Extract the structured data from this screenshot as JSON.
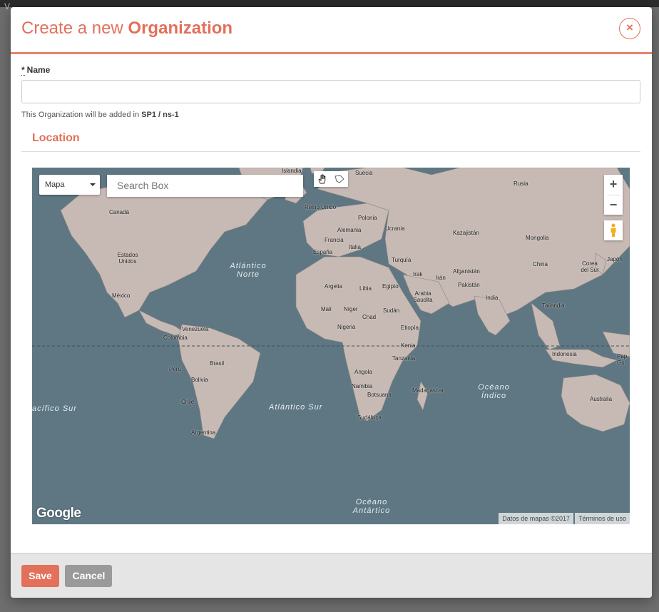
{
  "backdrop": {
    "partial_text": "V"
  },
  "modal": {
    "title_prefix": "Create a new ",
    "title_emphasis": "Organization",
    "close_symbol": "×"
  },
  "form": {
    "name_required_mark": "*",
    "name_label": "Name",
    "name_value": "",
    "help_prefix": "This Organization will be added in ",
    "help_location": "SP1 / ns-1"
  },
  "location": {
    "section_title": "Location",
    "map": {
      "map_type": "Mapa",
      "search_placeholder": "Search Box",
      "zoom_in": "+",
      "zoom_out": "−",
      "logo": "Google",
      "attribution_data": "Datos de mapas ©2017",
      "attribution_terms": "Términos de uso",
      "country_labels": [
        "Islandia",
        "Suecia",
        "Rusia",
        "Canadá",
        "Reino Unido",
        "Polonia",
        "Alemania",
        "Ucrania",
        "Kazajistán",
        "Francia",
        "Italia",
        "Mongolia",
        "España",
        "Turquía",
        "Estados Unidos",
        "Irak",
        "Irán",
        "Afganistán",
        "China",
        "Corea del Sur",
        "Japón",
        "Argelia",
        "Libia",
        "Egipto",
        "Pakistán",
        "México",
        "Arabia Saudita",
        "India",
        "Mali",
        "Níger",
        "Sudán",
        "Tailandia",
        "Chad",
        "Nigeria",
        "Etiopía",
        "Venezuela",
        "Colombia",
        "Kenia",
        "Indonesia",
        "Tanzania",
        "Brasil",
        "Perú",
        "Angola",
        "Bolivia",
        "Namibia",
        "Madagascar",
        "Botsuana",
        "Chile",
        "Sudáfrica",
        "Australia",
        "Argentina",
        "Pap Gui"
      ],
      "ocean_labels": [
        "Atlántico Norte",
        "Atlántico Sur",
        "Océano Índico",
        "acífico Sur",
        "Océano Antártico"
      ]
    }
  },
  "footer": {
    "save_label": "Save",
    "cancel_label": "Cancel"
  },
  "colors": {
    "accent": "#e2705a",
    "ocean": "#5e7783",
    "land": "#c7b9b3"
  },
  "icons": [
    "close-icon",
    "pan-hand-icon",
    "draw-polygon-icon",
    "pegman-icon",
    "dropdown-caret-icon"
  ]
}
